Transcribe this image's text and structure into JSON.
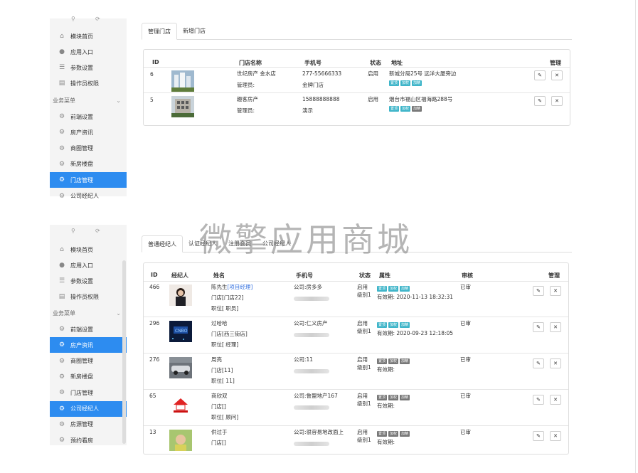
{
  "top": {
    "sidebar_items": [
      {
        "label": "模块首页",
        "icon": "home-icon"
      },
      {
        "label": "应用入口",
        "icon": "chat-icon"
      },
      {
        "label": "参数设置",
        "icon": "list-icon"
      },
      {
        "label": "操作员权限",
        "icon": "doc-icon"
      }
    ],
    "group_label": "业务菜单",
    "menu_items": [
      {
        "label": "前端设置",
        "active": false
      },
      {
        "label": "房产资讯",
        "active": false
      },
      {
        "label": "商圈管理",
        "active": false
      },
      {
        "label": "新房楼盘",
        "active": false
      },
      {
        "label": "门店管理",
        "active": true
      },
      {
        "label": "公司经纪人",
        "active": false
      }
    ],
    "tabs": [
      "管理门店",
      "新增门店"
    ],
    "headers": {
      "id": "ID",
      "name": "门店名称",
      "phone": "手机号",
      "status": "状态",
      "address": "地址",
      "manage": "管理"
    },
    "rows": [
      {
        "id": "6",
        "name": "世纪房产 金水店",
        "manager_label": "管理员:",
        "phone": "277-55666333",
        "manager": "金牌门店",
        "status": "启用",
        "address": "新城分局25号 远洋大厦旁边",
        "badges": [
          "置顶",
          "加权",
          "加精"
        ]
      },
      {
        "id": "5",
        "name": "趣客房产",
        "manager_label": "管理员:",
        "phone": "15888888888",
        "manager": "演示",
        "status": "启用",
        "address": "烟台市福山区福海路288号",
        "badges": [
          "置顶",
          "加权",
          "加精"
        ]
      }
    ]
  },
  "bottom": {
    "sidebar_items": [
      {
        "label": "模块首页",
        "icon": "home-icon"
      },
      {
        "label": "应用入口",
        "icon": "chat-icon"
      },
      {
        "label": "参数设置",
        "icon": "list-icon"
      },
      {
        "label": "操作员权限",
        "icon": "doc-icon"
      }
    ],
    "group_label": "业务菜单",
    "menu_items": [
      {
        "label": "前端设置",
        "active": false
      },
      {
        "label": "房产资讯",
        "active": true
      },
      {
        "label": "商圈管理",
        "active": false
      },
      {
        "label": "新房楼盘",
        "active": false
      },
      {
        "label": "门店管理",
        "active": false
      },
      {
        "label": "公司经纪人",
        "active": true
      },
      {
        "label": "房源管理",
        "active": false
      },
      {
        "label": "预约看房",
        "active": false
      }
    ],
    "tabs": [
      "普通经纪人",
      "认证经纪人",
      "注册会员",
      "公司经纪人"
    ],
    "headers": {
      "id": "ID",
      "agent": "经纪人",
      "name": "姓名",
      "phone": "手机号",
      "status": "状态",
      "attr": "属性",
      "audit": "审核",
      "manage": "管理"
    },
    "rows": [
      {
        "id": "466",
        "name": "陈先生",
        "tag": "[项目经理]",
        "store": "门店[门店22]",
        "position": "职位[ 职员]",
        "company": "公司:房多多",
        "status": "启用",
        "level": "级别1",
        "badges": [
          "置顶",
          "加权",
          "加精"
        ],
        "valid": "有效期: 2020-11-13 18:32:31",
        "audit": "已审"
      },
      {
        "id": "296",
        "name": "过哈哈",
        "tag": "",
        "store": "门店[西三街店]",
        "position": "职位[ 经理]",
        "company": "公司:仁义房产",
        "status": "启用",
        "level": "级别1",
        "badges": [
          "置顶",
          "加权",
          "加精"
        ],
        "valid": "有效期: 2020-09-23 12:18:05",
        "audit": "已审"
      },
      {
        "id": "276",
        "name": "周亮",
        "tag": "",
        "store": "门店[11]",
        "position": "职位[ 11]",
        "company": "公司:11",
        "status": "启用",
        "level": "级别1",
        "badges": [
          "置顶",
          "加权",
          "加精"
        ],
        "valid": "有效期:",
        "audit": "已审"
      },
      {
        "id": "65",
        "name": "商欣双",
        "tag": "",
        "store": "门店[]",
        "position": "职位[ 顾问]",
        "company": "公司:鲁盟地产167",
        "status": "启用",
        "level": "级别1",
        "badges": [
          "置顶",
          "加权",
          "加精"
        ],
        "valid": "有效期:",
        "audit": "已审"
      },
      {
        "id": "13",
        "name": "供过于",
        "tag": "",
        "store": "门店[]",
        "position": "",
        "company": "公司:很容易地改面上",
        "status": "启用",
        "level": "级别1",
        "badges": [
          "置顶",
          "加权",
          "加精"
        ],
        "valid": "有效期:",
        "audit": "已审"
      }
    ]
  },
  "watermark": "微擎应用商城",
  "colors": {
    "accent": "#2d8cf0",
    "badge_teal": "#3fb5c9",
    "badge_gray": "#777777"
  }
}
